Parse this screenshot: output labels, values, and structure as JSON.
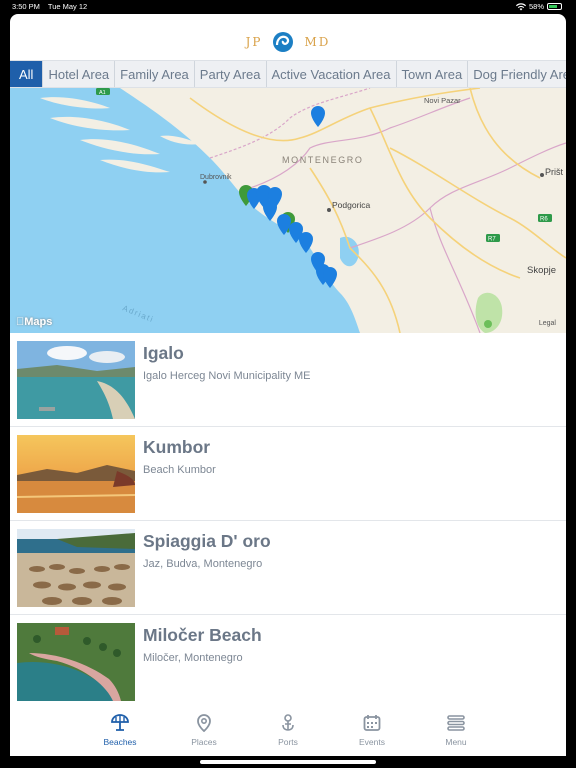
{
  "status": {
    "time": "3:50 PM",
    "date": "Tue May 12",
    "battery": "58%"
  },
  "logo": {
    "left": "JP",
    "right": "MD"
  },
  "tabs": [
    "All",
    "Hotel Area",
    "Family Area",
    "Party Area",
    "Active Vacation Area",
    "Town Area",
    "Dog Friendly Area"
  ],
  "map": {
    "brand": "Maps",
    "legal": "Legal",
    "labels": {
      "montenegro": "MONTENEGRO",
      "novi_pazar": "Novi Pazar",
      "dubrovnik": "Dubrovnik",
      "podgorica": "Podgorica",
      "pristina": "Prišt",
      "skopje": "Skopje",
      "adriatic": "Adriati",
      "road_a1": "A1",
      "road_r6": "R6",
      "road_r7": "R7"
    }
  },
  "beaches": [
    {
      "title": "Igalo",
      "subtitle": "Igalo Herceg Novi Municipality ME"
    },
    {
      "title": "Kumbor",
      "subtitle": "Beach Kumbor"
    },
    {
      "title": "Spiaggia D' oro",
      "subtitle": "Jaz, Budva, Montenegro"
    },
    {
      "title": "Miločer Beach",
      "subtitle": "Miločer, Montenegro"
    }
  ],
  "nav": [
    {
      "label": "Beaches",
      "icon": "umbrella-icon"
    },
    {
      "label": "Places",
      "icon": "location-pin-icon"
    },
    {
      "label": "Ports",
      "icon": "anchor-pin-icon"
    },
    {
      "label": "Events",
      "icon": "calendar-icon"
    },
    {
      "label": "Menu",
      "icon": "menu-icon"
    }
  ],
  "colors": {
    "accent": "#1f5faa",
    "logo": "#d9a24a",
    "sea": "#8fd0f2",
    "land": "#f3efe4"
  }
}
